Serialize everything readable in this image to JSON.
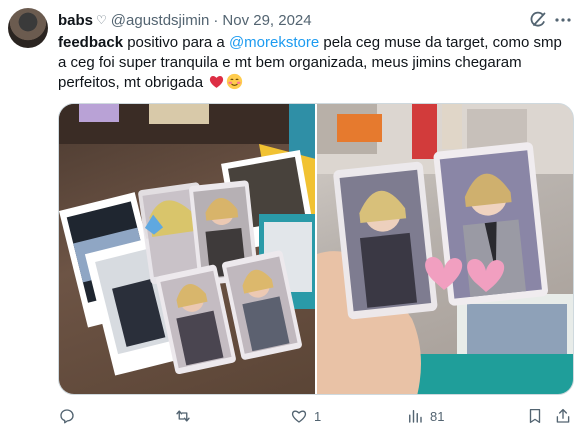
{
  "tweet": {
    "author": {
      "name": "babs",
      "name_badge": "♡",
      "handle": "@agustdsjimin"
    },
    "date_separator": "·",
    "date": "Nov 29, 2024",
    "text": {
      "bold": "feedback",
      "part1": " positivo para a ",
      "mention": "@morekstore",
      "part2": " pela ceg muse da target, como smp a ceg foi super tranquila e mt bem organizada, meus jimins chegaram perfeitos, mt obrigada "
    },
    "emojis": [
      "red-heart",
      "smiling-face-with-blush"
    ],
    "media": {
      "count": 2,
      "photos": [
        "photocards-on-table",
        "two-photocards-in-hand"
      ]
    },
    "actions": {
      "reply_count": "",
      "retweet_count": "",
      "like_count": "1",
      "views_count": "81"
    }
  },
  "colors": {
    "text": "#0f1419",
    "secondary": "#536471",
    "link": "#1d9bf0",
    "border": "#cfd9de",
    "heart_emoji": "#e0245e"
  }
}
